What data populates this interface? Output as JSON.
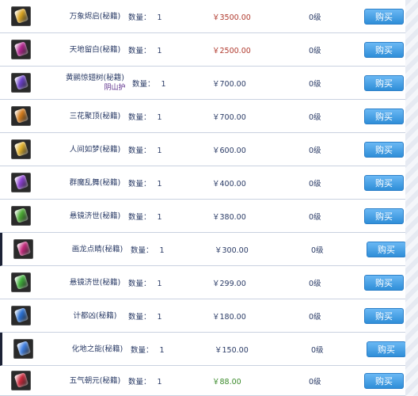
{
  "buy_label": "购买",
  "qty_label": "数量：",
  "items": [
    {
      "name": "万象烬启(秘籍)",
      "qty": "1",
      "price": "￥3500.00",
      "price_color": "#b03a2e",
      "level": "0级",
      "gem": "#d9a320",
      "h": 42
    },
    {
      "name": "天地留白(秘籍)",
      "qty": "1",
      "price": "￥2500.00",
      "price_color": "#b03a2e",
      "level": "0级",
      "gem": "#b0238c",
      "h": 42
    },
    {
      "name": "黄鹂惊翅树(秘籍)",
      "note": "阴山护",
      "qty": "1",
      "price": "￥700.00",
      "price_color": "#2a3b66",
      "level": "0级",
      "gem": "#6a3fc8",
      "h": 42
    },
    {
      "name": "三花聚顶(秘籍)",
      "qty": "1",
      "price": "￥700.00",
      "price_color": "#2a3b66",
      "level": "0级",
      "gem": "#d27a1a",
      "h": 42
    },
    {
      "name": "人间如梦(秘籍)",
      "qty": "1",
      "price": "￥600.00",
      "price_color": "#2a3b66",
      "level": "0级",
      "gem": "#e0b02a",
      "h": 42
    },
    {
      "name": "群魔乱舞(秘籍)",
      "qty": "1",
      "price": "￥400.00",
      "price_color": "#2a3b66",
      "level": "0级",
      "gem": "#8a3fd0",
      "h": 42
    },
    {
      "name": "悬镜济世(秘籍)",
      "qty": "1",
      "price": "￥380.00",
      "price_color": "#2a3b66",
      "level": "0级",
      "gem": "#4aa832",
      "h": 42
    },
    {
      "name": "画龙点睛(秘籍)",
      "qty": "1",
      "price": "￥300.00",
      "price_color": "#2a3b66",
      "level": "0级",
      "gem": "#c0287a",
      "h": 42
    },
    {
      "name": "悬镜济世(秘籍)",
      "qty": "1",
      "price": "￥299.00",
      "price_color": "#2a3b66",
      "level": "0级",
      "gem": "#3fae3a",
      "h": 42
    },
    {
      "name": "计都凶(秘籍)",
      "qty": "1",
      "price": "￥180.00",
      "price_color": "#2a3b66",
      "level": "0级",
      "gem": "#2a6fd0",
      "h": 42
    },
    {
      "name": "化地之能(秘籍)",
      "qty": "1",
      "price": "￥150.00",
      "price_color": "#2a3b66",
      "level": "0级",
      "gem": "#3f7ee0",
      "h": 42
    },
    {
      "name": "五气朝元(秘籍)",
      "qty": "1",
      "price": "￥88.00",
      "price_color": "#3a8a2a",
      "level": "0级",
      "gem": "#c8283a",
      "h": 38
    }
  ]
}
